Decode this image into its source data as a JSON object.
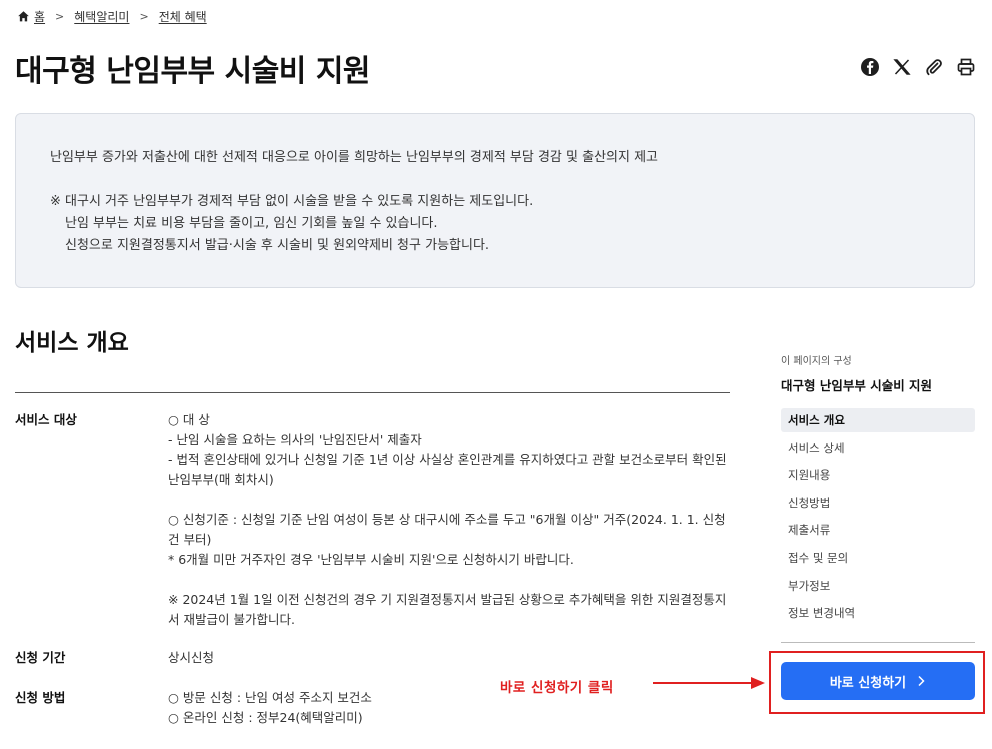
{
  "breadcrumb": {
    "home": "홈",
    "items": [
      "혜택알리미",
      "전체 혜택"
    ]
  },
  "page": {
    "title": "대구형 난임부부 시술비 지원"
  },
  "share": {
    "icons": [
      "facebook-icon",
      "x-icon",
      "link-icon",
      "print-icon"
    ]
  },
  "summary": {
    "lead": "난임부부 증가와 저출산에 대한 선제적 대응으로 아이를 희망하는 난임부부의 경제적 부담 경감 및 출산의지 제고",
    "notes": [
      "※ 대구시 거주 난임부부가 경제적 부담 없이 시술을 받을 수 있도록 지원하는 제도입니다.",
      "난임 부부는 치료 비용 부담을 줄이고, 임신 기회를 높일 수 있습니다.",
      "신청으로 지원결정통지서 발급·시술 후 시술비 및 원외약제비 청구 가능합니다."
    ]
  },
  "overview": {
    "title": "서비스 개요",
    "target": {
      "label": "서비스 대상",
      "lines": [
        "○ 대 상",
        "- 난임 시술을 요하는 의사의 '난임진단서' 제출자",
        "- 법적 혼인상태에 있거나 신청일 기준 1년 이상 사실상 혼인관계를 유지하였다고 관할 보건소로부터 확인된 난임부부(매 회차시)"
      ],
      "criteria": [
        "○ 신청기준 : 신청일 기준 난임 여성이 등본 상 대구시에 주소를 두고 \"6개월 이상\" 거주(2024. 1. 1. 신청건 부터)",
        "* 6개월 미만 거주자인 경우 '난임부부 시술비 지원'으로 신청하시기 바랍니다."
      ],
      "note": "※ 2024년 1월 1일 이전 신청건의 경우 기 지원결정통지서 발급된 상황으로 추가혜택을 위한 지원결정통지서 재발급이 불가합니다."
    },
    "period": {
      "label": "신청 기간",
      "value": "상시신청"
    },
    "method": {
      "label": "신청 방법",
      "lines": [
        "○ 방문 신청 : 난임 여성 주소지 보건소",
        "○ 온라인 신청 : 정부24(혜택알리미)"
      ]
    }
  },
  "toc": {
    "caption": "이 페이지의 구성",
    "heading": "대구형 난임부부 시술비 지원",
    "items": [
      "서비스 개요",
      "서비스 상세",
      "지원내용",
      "신청방법",
      "제출서류",
      "접수 및 문의",
      "부가정보",
      "정보 변경내역"
    ],
    "active_index": 0
  },
  "apply": {
    "label": "바로 신청하기"
  },
  "annotation": {
    "text": "바로 신청하기 클릭",
    "color": "#e02020"
  },
  "colors": {
    "primary": "#256ef4",
    "highlight": "#e02020",
    "summary_bg": "#f1f3f7"
  }
}
